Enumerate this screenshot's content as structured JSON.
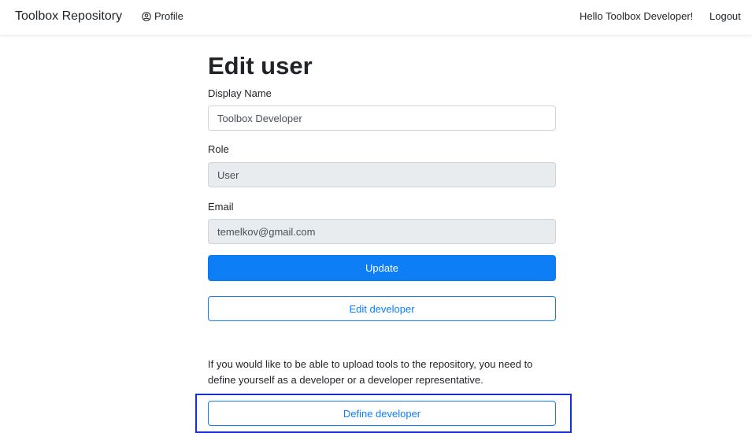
{
  "navbar": {
    "brand": "Toolbox Repository",
    "profile_label": "Profile",
    "greeting": "Hello Toolbox Developer!",
    "logout_label": "Logout"
  },
  "page": {
    "title": "Edit user"
  },
  "form": {
    "display_name_label": "Display Name",
    "display_name_value": "Toolbox Developer",
    "role_label": "Role",
    "role_value": "User",
    "email_label": "Email",
    "email_value": "temelkov@gmail.com",
    "update_label": "Update",
    "edit_developer_label": "Edit developer"
  },
  "developer_info": {
    "text": "If you would like to be able to upload tools to the repository, you need to define yourself as a developer or a developer representative.",
    "define_developer_label": "Define developer"
  },
  "colors": {
    "primary": "#0d7ef5",
    "readonly_bg": "#e9ecef",
    "focus_outline": "#1a2fd0"
  }
}
